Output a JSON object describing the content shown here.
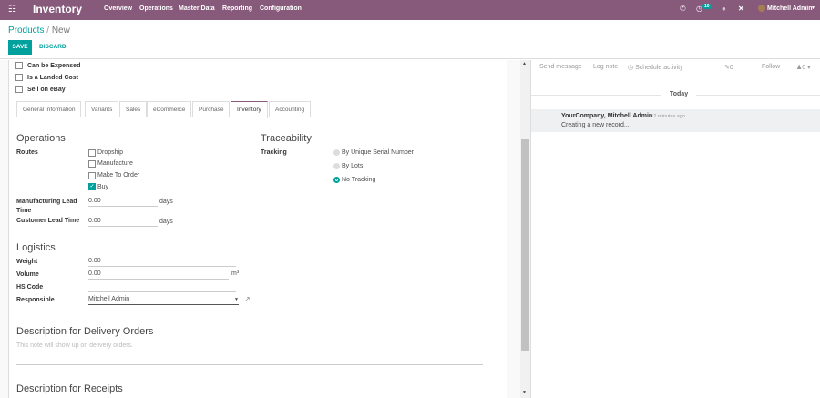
{
  "nav": {
    "app": "Inventory",
    "menu": [
      "Overview",
      "Operations",
      "Master Data",
      "Reporting",
      "Configuration"
    ],
    "badge": "10",
    "user": "Mitchell Admin"
  },
  "breadcrumb": {
    "parent": "Products",
    "current": "New"
  },
  "buttons": {
    "save": "SAVE",
    "discard": "DISCARD"
  },
  "checks": [
    {
      "label": "Can be Expensed",
      "checked": false
    },
    {
      "label": "Is a Landed Cost",
      "checked": false
    },
    {
      "label": "Sell on eBay",
      "checked": false
    }
  ],
  "tabs": [
    "General Information",
    "Variants",
    "Sales",
    "eCommerce",
    "Purchase",
    "Inventory",
    "Accounting"
  ],
  "operations": {
    "title": "Operations",
    "routes_label": "Routes",
    "routes": [
      {
        "label": "Dropship",
        "checked": false
      },
      {
        "label": "Manufacture",
        "checked": false
      },
      {
        "label": "Make To Order",
        "checked": false
      },
      {
        "label": "Buy",
        "checked": true
      }
    ],
    "mfg_label": "Manufacturing Lead Time",
    "mfg_value": "0.00",
    "cust_label": "Customer Lead Time",
    "cust_value": "0.00",
    "days": "days"
  },
  "traceability": {
    "title": "Traceability",
    "label": "Tracking",
    "options": [
      "By Unique Serial Number",
      "By Lots",
      "No Tracking"
    ],
    "selected": "No Tracking"
  },
  "logistics": {
    "title": "Logistics",
    "weight_label": "Weight",
    "weight": "0.00",
    "volume_label": "Volume",
    "volume": "0.00",
    "volume_unit": "m³",
    "hs_label": "HS Code",
    "hs": "",
    "resp_label": "Responsible",
    "resp": "Mitchell Admin"
  },
  "delivery": {
    "title": "Description for Delivery Orders",
    "placeholder": "This note will show up on delivery orders."
  },
  "receipts": {
    "title": "Description for Receipts"
  },
  "chatter": {
    "send": "Send message",
    "log": "Log note",
    "schedule": "Schedule activity",
    "attachments": "0",
    "follow": "Follow",
    "followers": "0",
    "today": "Today",
    "author": "YourCompany, Mitchell Admin",
    "time": "- 12 minutes ago",
    "body": "Creating a new record..."
  }
}
